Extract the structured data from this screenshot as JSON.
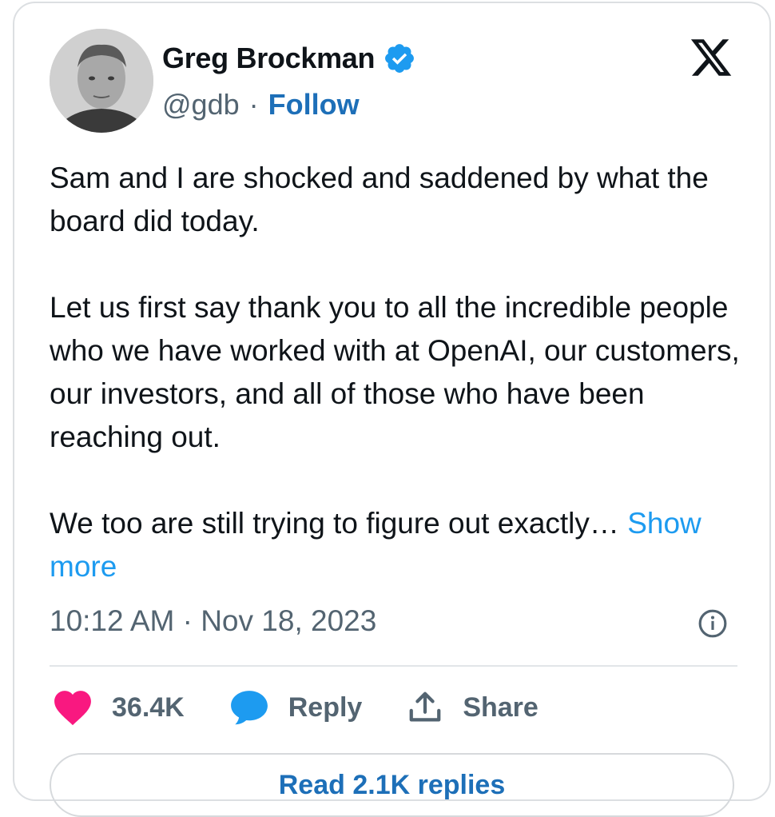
{
  "author": {
    "name": "Greg Brockman",
    "handle": "@gdb",
    "separator": "·",
    "follow_label": "Follow",
    "verified": true,
    "avatar_icon": "person-avatar"
  },
  "platform": {
    "logo_icon": "x-logo-icon"
  },
  "tweet": {
    "paragraphs": [
      "Sam and I are shocked and saddened by what the board did today.",
      "Let us first say thank you to all the incredible people who we have worked with at OpenAI, our customers, our investors, and all of those who have been reaching out.",
      "We too are still trying to figure out exactly…"
    ],
    "show_more_label": "Show more",
    "timestamp": "10:12 AM · Nov 18, 2023"
  },
  "actions": {
    "likes_count": "36.4K",
    "reply_label": "Reply",
    "share_label": "Share"
  },
  "replies_button": {
    "label": "Read 2.1K replies"
  },
  "colors": {
    "accent": "#1d9bf0",
    "link": "#1d6fb8",
    "like": "#f91880",
    "muted": "#536471",
    "text": "#0f1419"
  }
}
